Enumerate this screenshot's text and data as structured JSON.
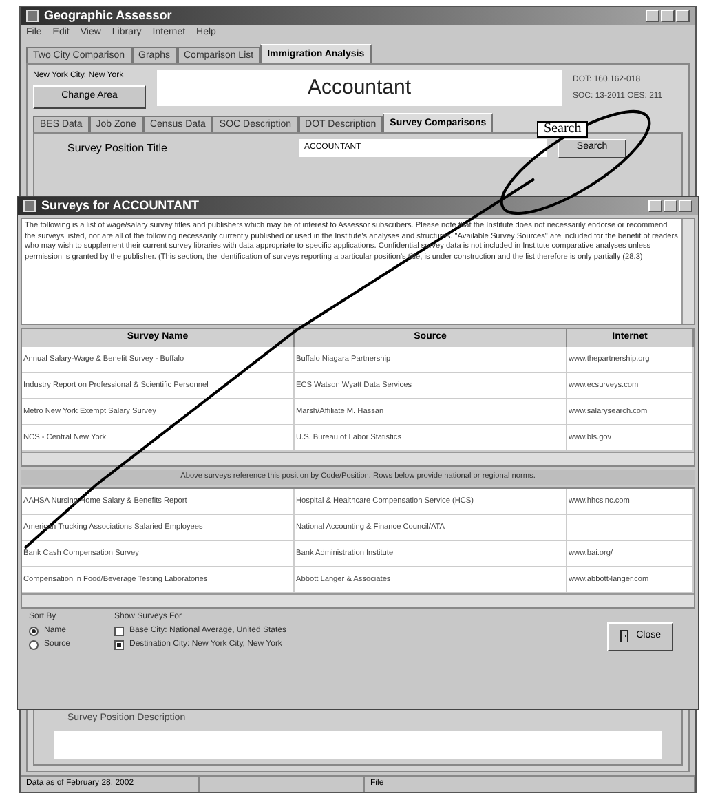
{
  "window": {
    "title": "Geographic Assessor"
  },
  "menu": [
    "File",
    "Edit",
    "View",
    "Library",
    "Internet",
    "Help"
  ],
  "tabs": [
    {
      "label": "Two City Comparison",
      "selected": false
    },
    {
      "label": "Graphs",
      "selected": false
    },
    {
      "label": "Comparison List",
      "selected": false
    },
    {
      "label": "Immigration Analysis",
      "selected": true
    }
  ],
  "area": {
    "location": "New York City, New York",
    "change_button": "Change Area",
    "position": "Accountant",
    "codes": [
      "DOT: 160.162-018",
      "SOC: 13-2011  OES: 211"
    ]
  },
  "subtabs": [
    {
      "label": "BES Data",
      "selected": false
    },
    {
      "label": "Job Zone",
      "selected": false
    },
    {
      "label": "Census Data",
      "selected": false
    },
    {
      "label": "SOC Description",
      "selected": false
    },
    {
      "label": "DOT Description",
      "selected": false
    },
    {
      "label": "Survey Comparisons",
      "selected": true
    }
  ],
  "survey_title": {
    "label": "Survey Position Title",
    "value": "ACCOUNTANT",
    "button": "Search"
  },
  "annotation": {
    "label": "Search"
  },
  "dialog": {
    "title": "Surveys for ACCOUNTANT",
    "intro": "The following is a list of wage/salary survey titles and publishers which may be of interest to Assessor subscribers. Please note that the Institute does not necessarily endorse or recommend the surveys listed, nor are all of the following necessarily currently published or used in the Institute's analyses and structures. \"Available Survey Sources\" are included for the benefit of readers who may wish to supplement their current survey libraries with data appropriate to specific applications. Confidential survey data is not included in Institute comparative analyses unless permission is granted by the publisher. (This section, the identification of surveys reporting a particular position's title, is under construction and the list therefore is only partially (28.3)",
    "columns": [
      "Survey Name",
      "Source",
      "Internet"
    ],
    "rows": [
      [
        "Annual Salary-Wage & Benefit Survey - Buffalo",
        "Buffalo Niagara Partnership",
        "www.thepartnership.org"
      ],
      [
        "Industry Report on Professional & Scientific Personnel",
        "ECS Watson Wyatt Data Services",
        "www.ecsurveys.com"
      ],
      [
        "Metro New York Exempt Salary Survey",
        "Marsh/Affiliate M. Hassan",
        "www.salarysearch.com"
      ],
      [
        "NCS - Central New York",
        "U.S. Bureau of Labor Statistics",
        "www.bls.gov"
      ]
    ],
    "banner": "Above surveys reference this position by Code/Position. Rows below provide national or regional norms.",
    "rows2": [
      [
        "AAHSA Nursing Home Salary & Benefits Report",
        "Hospital & Healthcare Compensation Service (HCS)",
        "www.hhcsinc.com"
      ],
      [
        "American Trucking Associations Salaried Employees",
        "National Accounting & Finance Council/ATA"
      ],
      [
        "Bank Cash Compensation Survey",
        "Bank Administration Institute",
        "www.bai.org/"
      ],
      [
        "Compensation in Food/Beverage Testing Laboratories",
        "Abbott Langer & Associates",
        "www.abbott-langer.com"
      ]
    ],
    "sort_by": {
      "label": "Sort By",
      "options": [
        {
          "label": "Name",
          "selected": true
        },
        {
          "label": "Source",
          "selected": false
        }
      ]
    },
    "show_for": {
      "label": "Show Surveys For",
      "options": [
        {
          "label": "Base City: National Average, United States",
          "checked": false
        },
        {
          "label": "Destination City: New York City, New York",
          "checked": true
        }
      ]
    },
    "close_button": "Close"
  },
  "description": {
    "label": "Survey Position Description"
  },
  "status_bar": [
    "Data as of February 28, 2002",
    "File"
  ]
}
